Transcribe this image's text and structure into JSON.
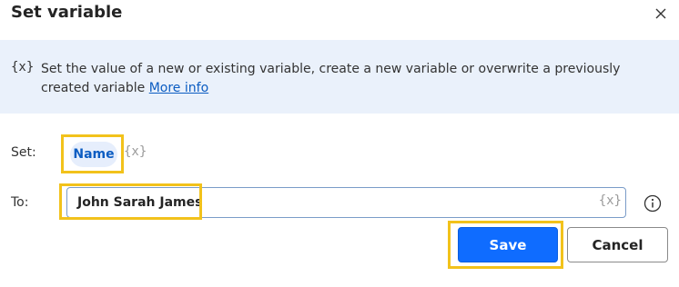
{
  "dialog": {
    "title": "Set variable"
  },
  "banner": {
    "icon_text": "{x}",
    "description": "Set the value of a new or existing variable, create a new variable or overwrite a previously created variable ",
    "link_text": "More info"
  },
  "set_row": {
    "label": "Set:",
    "variable_name": "Name",
    "variable_icon": "{x}"
  },
  "to_row": {
    "label": "To:",
    "value": "John Sarah James",
    "variable_icon": "{x}"
  },
  "actions": {
    "save_label": "Save",
    "cancel_label": "Cancel"
  },
  "colors": {
    "accent": "#0f6cff",
    "banner_bg": "#eaf1fb",
    "highlight": "#f2c21b",
    "link": "#0b5cc2"
  }
}
